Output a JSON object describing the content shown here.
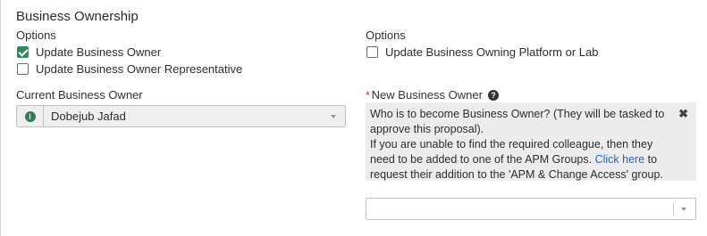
{
  "section": {
    "title": "Business Ownership"
  },
  "left_options": {
    "label": "Options",
    "items": [
      {
        "label": "Update Business Owner",
        "checked": true
      },
      {
        "label": "Update Business Owner Representative",
        "checked": false
      }
    ]
  },
  "right_options": {
    "label": "Options",
    "items": [
      {
        "label": "Update Business Owning Platform or Lab",
        "checked": false
      }
    ]
  },
  "current_owner": {
    "label": "Current Business Owner",
    "value": "Dobejub Jafad",
    "icon": "info-icon"
  },
  "new_owner": {
    "required_marker": "*",
    "label": "New Business Owner",
    "help_icon": "question-circle-icon",
    "info": {
      "line1": "Who is to become Business Owner? (They will be tasked to approve this proposal).",
      "line2_prefix": "If you are unable to find the required colleague, then they need to be added to one of the APM Groups.",
      "link": "Click here",
      "line2_suffix": "to request their addition to the 'APM & Change Access' group.",
      "close": "✖"
    },
    "select_value": ""
  },
  "colors": {
    "check_green": "#2e8a5c",
    "info_green": "#2e7d55",
    "link_blue": "#2b66c4",
    "required_red": "#c0392b",
    "info_box_bg": "#ececec"
  }
}
